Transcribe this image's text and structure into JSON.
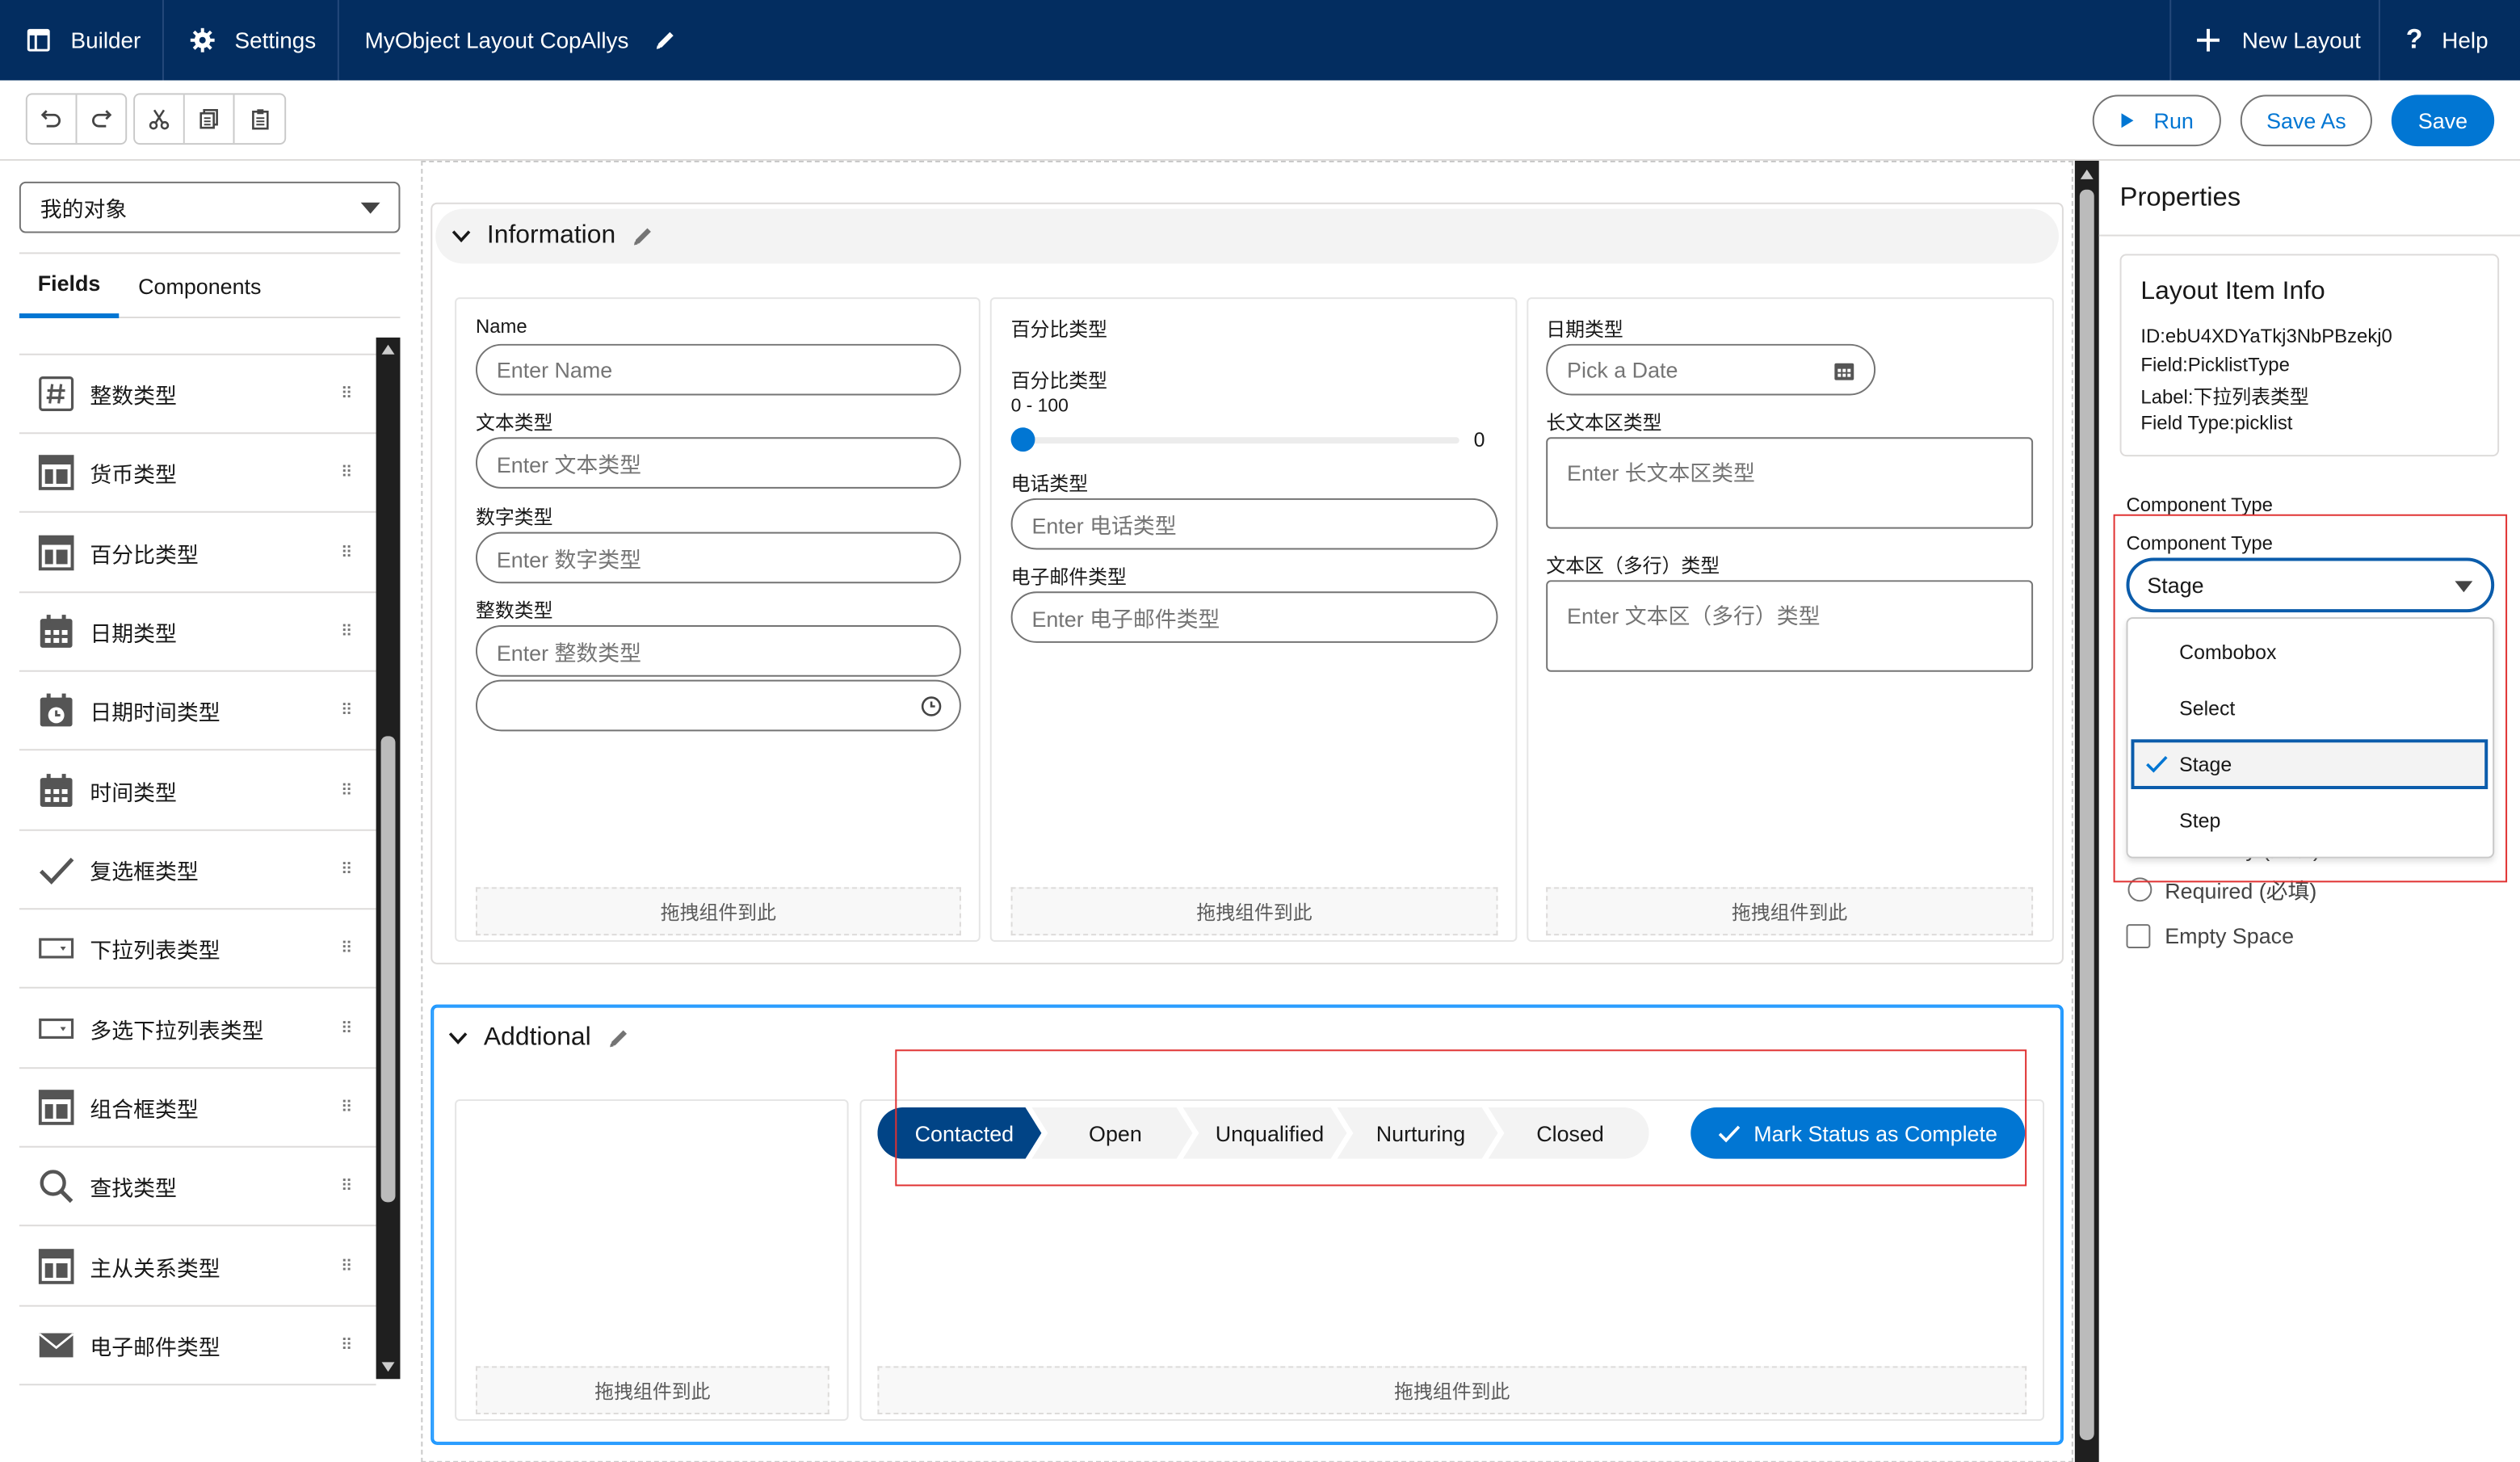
{
  "topbar": {
    "builder": "Builder",
    "settings": "Settings",
    "layout_name": "MyObject Layout CopAllys",
    "new_layout": "New Layout",
    "help": "Help"
  },
  "toolbar": {
    "run": "Run",
    "save_as": "Save As",
    "save": "Save"
  },
  "left_panel": {
    "object_select": "我的对象",
    "tabs": [
      "Fields",
      "Components"
    ],
    "active_tab": "Fields",
    "fields": [
      {
        "label": "整数类型",
        "icon": "number-icon"
      },
      {
        "label": "货币类型",
        "icon": "table-icon"
      },
      {
        "label": "百分比类型",
        "icon": "table-icon"
      },
      {
        "label": "日期类型",
        "icon": "calendar-icon"
      },
      {
        "label": "日期时间类型",
        "icon": "calendar-clock-icon"
      },
      {
        "label": "时间类型",
        "icon": "calendar-icon"
      },
      {
        "label": "复选框类型",
        "icon": "check-icon"
      },
      {
        "label": "下拉列表类型",
        "icon": "picklist-icon"
      },
      {
        "label": "多选下拉列表类型",
        "icon": "picklist-icon"
      },
      {
        "label": "组合框类型",
        "icon": "table-icon"
      },
      {
        "label": "查找类型",
        "icon": "search-icon"
      },
      {
        "label": "主从关系类型",
        "icon": "table-icon"
      },
      {
        "label": "电子邮件类型",
        "icon": "email-icon"
      }
    ]
  },
  "section1": {
    "title": "Information",
    "col1": {
      "name_label": "Name",
      "name_placeholder": "Enter Name",
      "text_label": "文本类型",
      "text_placeholder": "Enter 文本类型",
      "number_label": "数字类型",
      "number_placeholder": "Enter 数字类型",
      "integer_label": "整数类型",
      "integer_placeholder": "Enter 整数类型",
      "drop_hint": "拖拽组件到此"
    },
    "col2": {
      "header": "百分比类型",
      "slider_label": "百分比类型",
      "slider_range": "0 - 100",
      "slider_value": "0",
      "phone_label": "电话类型",
      "phone_placeholder": "Enter 电话类型",
      "email_label": "电子邮件类型",
      "email_placeholder": "Enter 电子邮件类型",
      "drop_hint": "拖拽组件到此"
    },
    "col3": {
      "date_label": "日期类型",
      "date_placeholder": "Pick a Date",
      "longtext_label": "长文本区类型",
      "longtext_placeholder": "Enter 长文本区类型",
      "textarea_label": "文本区（多行）类型",
      "textarea_placeholder": "Enter 文本区（多行）类型",
      "drop_hint": "拖拽组件到此"
    }
  },
  "section2": {
    "title": "Addtional",
    "drop_hint_left": "拖拽组件到此",
    "drop_hint_right": "拖拽组件到此",
    "path_steps": [
      "Contacted",
      "Open",
      "Unqualified",
      "Nurturing",
      "Closed"
    ],
    "active_step": "Contacted",
    "mark_button": "Mark Status as Complete"
  },
  "properties": {
    "title": "Properties",
    "card_title": "Layout Item Info",
    "id": "ID:ebU4XDYaTkj3NbPBzekj0",
    "field": "Field:PicklistType",
    "label": "Label:下拉列表类型",
    "field_type": "Field Type:picklist",
    "section_label": "Component Type",
    "combo_label": "Component Type",
    "combo_value": "Stage",
    "options": [
      "Combobox",
      "Select",
      "Stage",
      "Step"
    ],
    "selected_option": "Stage",
    "readonly_partial": "Readonly (只读)",
    "required": "Required (必填)",
    "empty_space": "Empty Space"
  },
  "colors": {
    "topbar": "#032d60",
    "brand": "#0176d3",
    "path_active": "#014486",
    "highlight": "#e03131"
  }
}
